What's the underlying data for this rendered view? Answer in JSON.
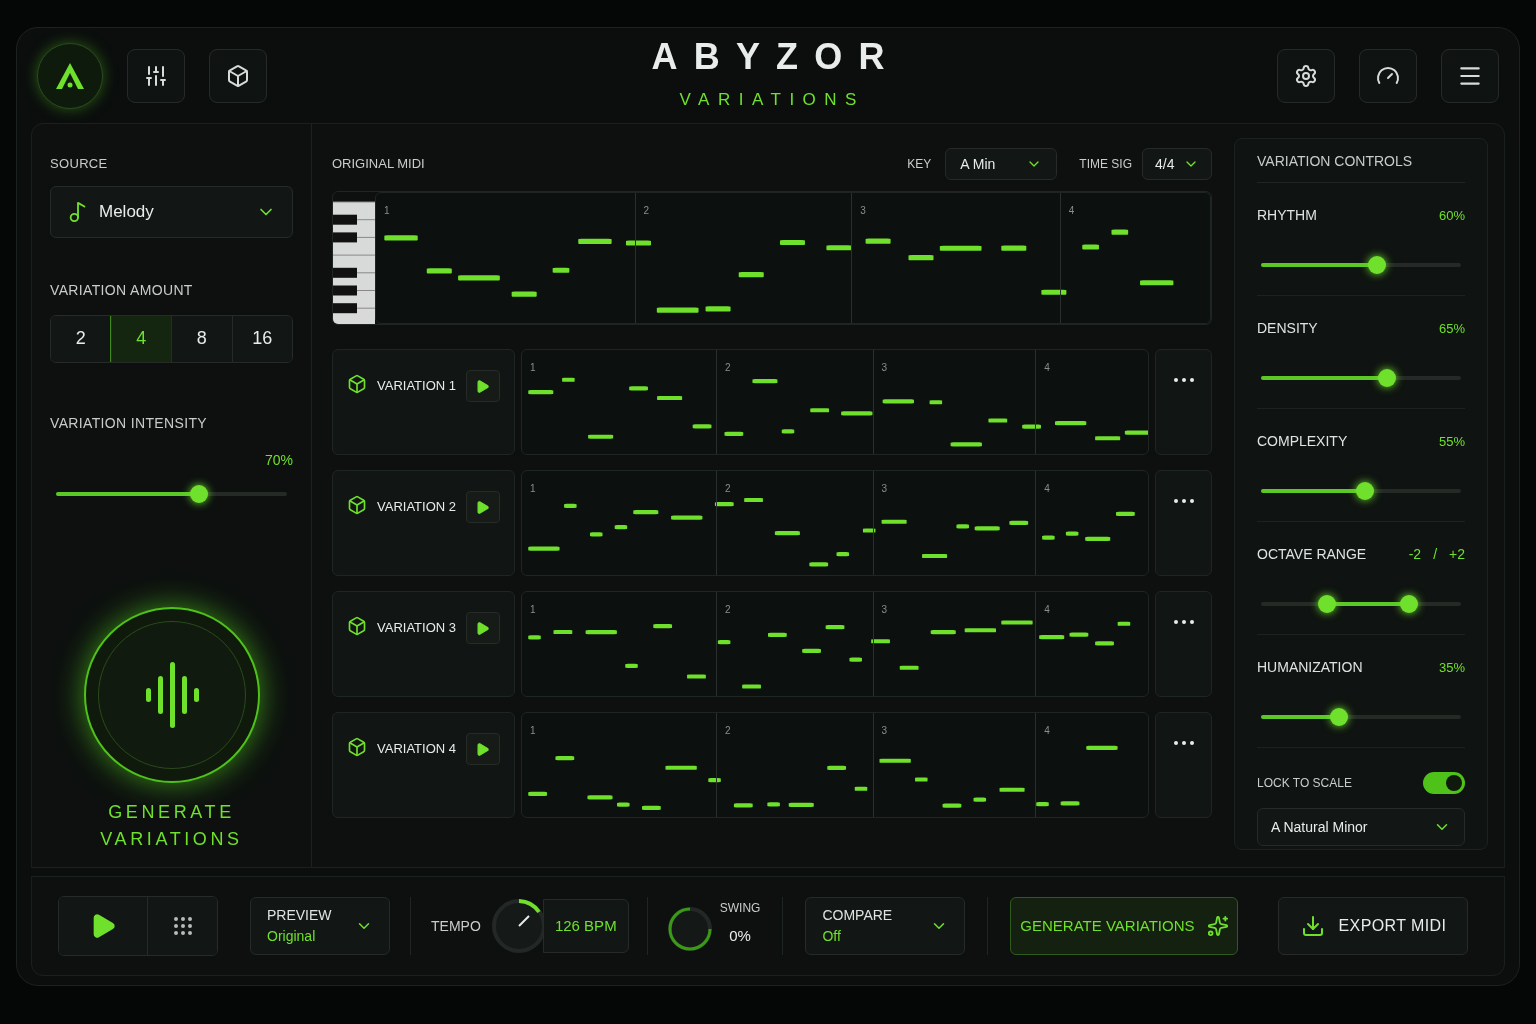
{
  "header": {
    "title": "ABYZOR",
    "subtitle": "VARIATIONS"
  },
  "source": {
    "label": "SOURCE",
    "value": "Melody"
  },
  "variation_amount": {
    "label": "VARIATION AMOUNT",
    "options": [
      {
        "label": "2",
        "selected": false
      },
      {
        "label": "4",
        "selected": true
      },
      {
        "label": "8",
        "selected": false
      },
      {
        "label": "16",
        "selected": false
      }
    ]
  },
  "variation_intensity": {
    "label": "VARIATION INTENSITY",
    "reading": "70%",
    "level": 0.62
  },
  "generate_pad": {
    "label": "GENERATE VARIATIONS"
  },
  "original_midi": {
    "title": "ORIGINAL MIDI",
    "key_label": "KEY",
    "key": "A Min",
    "time_sig_label": "TIME SIG",
    "time_sig": "4/4",
    "bars": [
      "1",
      "2",
      "3",
      "4"
    ]
  },
  "variations": [
    {
      "name": "VARIATION 1",
      "bars": [
        "1",
        "2",
        "3",
        "4"
      ]
    },
    {
      "name": "VARIATION 2",
      "bars": [
        "1",
        "2",
        "3",
        "4"
      ]
    },
    {
      "name": "VARIATION 3",
      "bars": [
        "1",
        "2",
        "3",
        "4"
      ]
    },
    {
      "name": "VARIATION 4",
      "bars": [
        "1",
        "2",
        "3",
        "4"
      ]
    }
  ],
  "variation_controls": {
    "title": "VARIATION CONTROLS",
    "sliders": [
      {
        "kind": "single",
        "label": "RHYTHM",
        "reading": "60%",
        "level": 0.58
      },
      {
        "kind": "single",
        "label": "DENSITY",
        "reading": "65%",
        "level": 0.63
      },
      {
        "kind": "single",
        "label": "COMPLEXITY",
        "reading": "55%",
        "level": 0.52
      },
      {
        "kind": "range",
        "label": "OCTAVE RANGE",
        "low": "-2",
        "separator": "/",
        "high": "+2",
        "thumbs": [
          {
            "level": 0.33
          },
          {
            "level": 0.74
          }
        ]
      },
      {
        "kind": "single",
        "label": "HUMANIZATION",
        "reading": "35%",
        "level": 0.39
      }
    ],
    "lock_to_scale": {
      "label": "LOCK TO SCALE",
      "on": true
    },
    "scale": "A Natural Minor"
  },
  "bottom_bar": {
    "preview": {
      "label": "PREVIEW",
      "value": "Original"
    },
    "tempo": {
      "label": "TEMPO",
      "value": "126 BPM"
    },
    "swing": {
      "label": "SWING",
      "value": "0%"
    },
    "compare": {
      "label": "COMPARE",
      "value": "Off"
    },
    "generate_button": "GENERATE VARIATIONS",
    "export_button": "EXPORT MIDI"
  }
}
